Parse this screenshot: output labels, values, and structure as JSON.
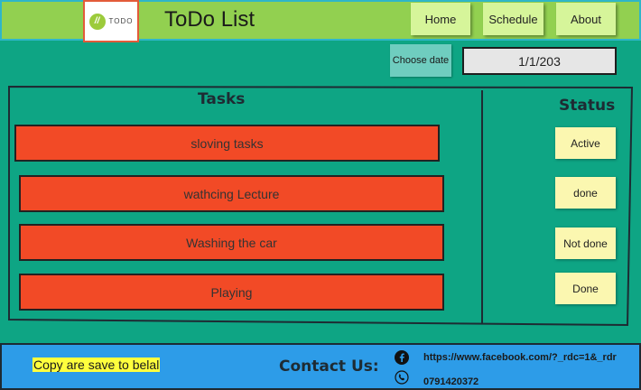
{
  "header": {
    "logo_text": "TODO",
    "logo_mark": "//",
    "title": "ToDo List",
    "nav": [
      {
        "label": "Home"
      },
      {
        "label": "Schedule"
      },
      {
        "label": "About"
      }
    ]
  },
  "date_picker": {
    "button_label": "Choose date",
    "value": "1/1/203"
  },
  "tasks": {
    "heading": "Tasks",
    "items": [
      {
        "label": "sloving tasks"
      },
      {
        "label": "wathcing Lecture"
      },
      {
        "label": "Washing the car"
      },
      {
        "label": "Playing"
      }
    ]
  },
  "status": {
    "heading": "Status",
    "items": [
      {
        "label": "Active"
      },
      {
        "label": "done"
      },
      {
        "label": "Not done"
      },
      {
        "label": "Done"
      }
    ]
  },
  "footer": {
    "copyright": "Copy are save to belal",
    "contact_label": "Contact Us:",
    "facebook_link": "https://www.facebook.com/?_rdc=1&_rdr",
    "phone": "0791420372",
    "icons": [
      "facebook-icon",
      "phone-icon"
    ]
  },
  "colors": {
    "header_bg": "#92d050",
    "body_bg": "#0ea584",
    "task_bg": "#f24a26",
    "status_bg": "#fbf7b0",
    "footer_bg": "#2d9ce8",
    "highlight": "#ffff3d"
  }
}
